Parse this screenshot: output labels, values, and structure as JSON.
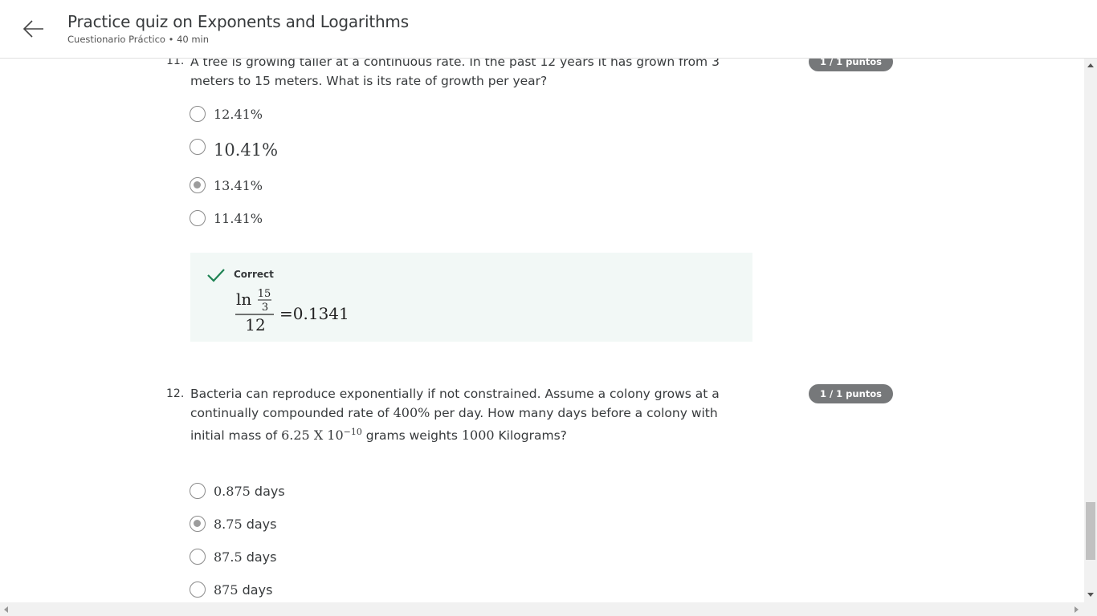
{
  "header": {
    "title": "Practice quiz on Exponents and Logarithms",
    "subtitle": "Cuestionario Práctico • 40 min"
  },
  "questions": [
    {
      "number": "11.",
      "text": "A tree is growing taller at a continuous rate. In the past 12 years it has grown from 3 meters to 15 meters. What is its rate of growth per year?",
      "points": "1 / 1 puntos",
      "options": [
        "12.41%",
        "10.41%",
        "13.41%",
        "11.41%"
      ],
      "selected_index": 2,
      "feedback": {
        "status": "Correct",
        "formula_fn": "ln",
        "formula_inner_num": "15",
        "formula_inner_den": "3",
        "formula_den": "12",
        "formula_result": "=0.1341"
      }
    },
    {
      "number": "12.",
      "text_part1": "Bacteria can reproduce exponentially if not constrained. Assume a colony grows at a continually compounded rate of ",
      "rate": "400%",
      "text_part2": " per day. How many days before a colony with initial mass of ",
      "mass": "6.25 X 10",
      "mass_exp": "−10",
      "text_part3": " grams weights ",
      "weight": "1000",
      "text_part4": " Kilograms?",
      "points": "1 / 1 puntos",
      "options": [
        {
          "value": "0.875",
          "unit": "days"
        },
        {
          "value": "8.75",
          "unit": "days"
        },
        {
          "value": "87.5",
          "unit": "days"
        },
        {
          "value": "875",
          "unit": "days"
        }
      ],
      "selected_index": 1
    }
  ],
  "colors": {
    "badge": "#76787a",
    "feedback_bg": "#f2f8f6",
    "check": "#1f8354"
  },
  "icons": [
    "back-arrow-icon",
    "checkmark-icon",
    "radio-icon"
  ]
}
